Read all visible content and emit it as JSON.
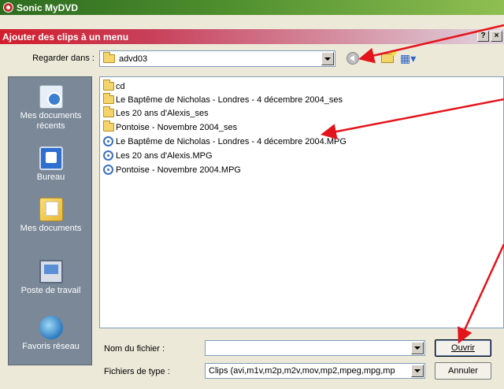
{
  "app": {
    "title": "Sonic MyDVD"
  },
  "dialog": {
    "title": "Ajouter des clips à un menu",
    "help_button": "?",
    "close_button": "×"
  },
  "lookin": {
    "label": "Regarder dans :",
    "value": "advd03"
  },
  "places": [
    {
      "label": "Mes documents récents",
      "icon": "recent-documents-icon"
    },
    {
      "label": "Bureau",
      "icon": "desktop-icon"
    },
    {
      "label": "Mes documents",
      "icon": "my-documents-icon"
    },
    {
      "label": "Poste de travail",
      "icon": "my-computer-icon"
    },
    {
      "label": "Favoris réseau",
      "icon": "network-places-icon"
    }
  ],
  "files": [
    {
      "name": "cd",
      "type": "folder"
    },
    {
      "name": "Le Baptême de Nicholas - Londres - 4 décembre 2004_ses",
      "type": "folder"
    },
    {
      "name": "Les 20 ans d'Alexis_ses",
      "type": "folder"
    },
    {
      "name": "Pontoise - Novembre 2004_ses",
      "type": "folder"
    },
    {
      "name": "Le Baptême de Nicholas - Londres - 4 décembre 2004.MPG",
      "type": "mpg"
    },
    {
      "name": "Les 20 ans d'Alexis.MPG",
      "type": "mpg"
    },
    {
      "name": "Pontoise - Novembre 2004.MPG",
      "type": "mpg"
    }
  ],
  "filename": {
    "label": "Nom du fichier :",
    "value": ""
  },
  "filetype": {
    "label": "Fichiers de type :",
    "value": "Clips (avi,m1v,m2p,m2v,mov,mp2,mpeg,mpg,mp"
  },
  "buttons": {
    "ok": "Ouvrir",
    "cancel": "Annuler"
  },
  "colors": {
    "annotation_arrow": "#e4141c",
    "app_titlebar": "#4f8f2e",
    "dialog_titlebar": "#d21e2c",
    "places_bar": "#7a8898"
  }
}
